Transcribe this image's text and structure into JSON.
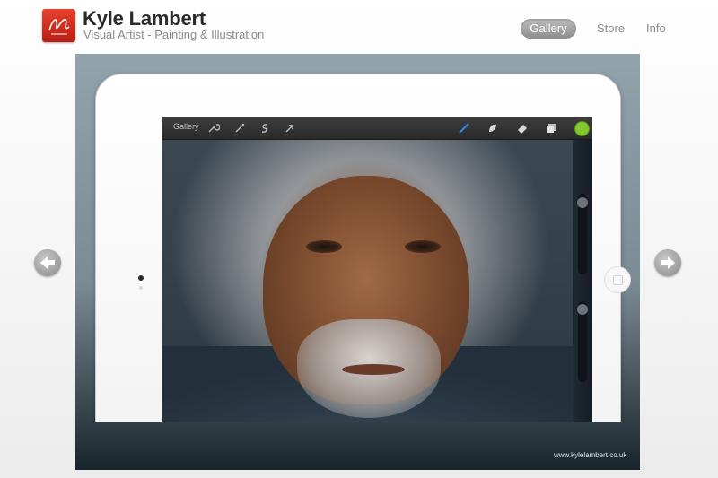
{
  "header": {
    "title": "Kyle Lambert",
    "subtitle": "Visual Artist - Painting & Illustration",
    "nav": [
      {
        "label": "Gallery",
        "active": true
      },
      {
        "label": "Store",
        "active": false
      },
      {
        "label": "Info",
        "active": false
      }
    ]
  },
  "app": {
    "toolbar_label": "Gallery",
    "tools": [
      "wrench-icon",
      "magic-wand-icon",
      "s-curve-icon",
      "arrow-icon",
      "brush-icon",
      "smudge-icon",
      "eraser-icon",
      "layers-icon"
    ],
    "color_swatch": "#84c92b"
  },
  "footer": {
    "watermark": "www.kylelambert.co.uk"
  },
  "colors": {
    "logo": "#c92a1b",
    "active_nav_bg": "#9e9e9e"
  }
}
